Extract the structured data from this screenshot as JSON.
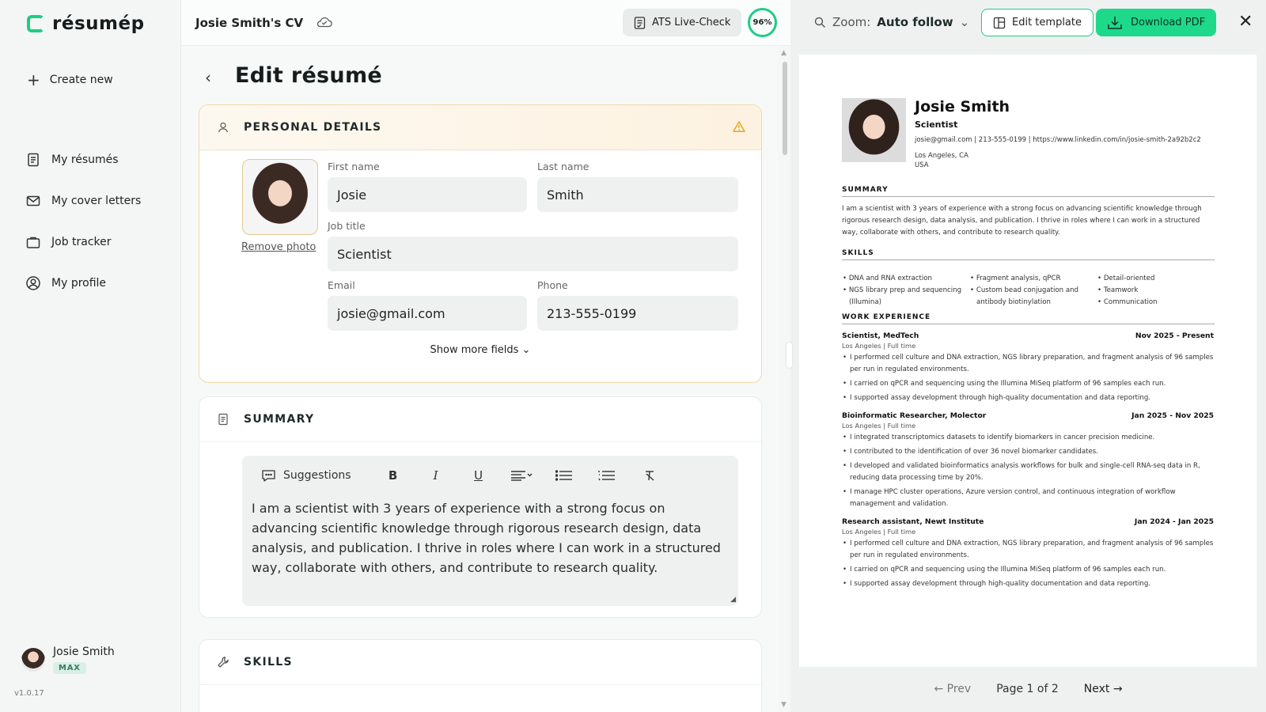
{
  "sidebar": {
    "logo": "résumép",
    "create_new": "Create new",
    "items": [
      {
        "label": "My résumés",
        "icon": "document-icon"
      },
      {
        "label": "My cover letters",
        "icon": "mail-icon"
      },
      {
        "label": "Job tracker",
        "icon": "briefcase-icon"
      },
      {
        "label": "My profile",
        "icon": "user-circle-icon"
      }
    ],
    "user_name": "Josie Smith",
    "plan": "MAX",
    "version": "v1.0.17"
  },
  "topbar": {
    "doc_title": "Josie Smith's CV",
    "ats_label": "ATS Live-Check",
    "score": "96%"
  },
  "editor": {
    "heading": "Edit résumé",
    "personal": {
      "title": "PERSONAL DETAILS",
      "remove_photo": "Remove photo",
      "first_name_label": "First name",
      "first_name": "Josie",
      "last_name_label": "Last name",
      "last_name": "Smith",
      "job_title_label": "Job title",
      "job_title": "Scientist",
      "email_label": "Email",
      "email": "josie@gmail.com",
      "phone_label": "Phone",
      "phone": "213-555-0199",
      "show_more": "Show more fields"
    },
    "summary": {
      "title": "SUMMARY",
      "suggestions": "Suggestions",
      "text": "I am a scientist with 3 years of experience with a strong focus on advancing scientific knowledge through rigorous research design, data analysis, and publication. I thrive in roles where I can work in a structured way, collaborate  with others, and contribute to research quality."
    },
    "skills_title": "SKILLS"
  },
  "preview": {
    "zoom_label": "Zoom:",
    "zoom_value": "Auto follow",
    "edit_template": "Edit template",
    "download": "Download PDF",
    "prev": "← Prev",
    "page": "Page 1 of 2",
    "next": "Next →",
    "cv": {
      "name": "Josie Smith",
      "title": "Scientist",
      "contact": "josie@gmail.com | 213-555-0199 | https://www.linkedin.com/in/josie-smith-2a92b2c2",
      "city": "Los Angeles, CA",
      "country": "USA",
      "summary_h": "SUMMARY",
      "summary": "I am a scientist with 3 years of experience with a strong focus on advancing scientific knowledge through rigorous research design, data analysis, and publication. I thrive in roles where I can work in a structured way, collaborate with others, and contribute to research quality.",
      "skills_h": "SKILLS",
      "skills": [
        [
          "DNA and RNA extraction",
          "NGS library prep and sequencing (Illumina)"
        ],
        [
          "Fragment analysis, qPCR",
          "Custom bead conjugation and antibody biotinylation"
        ],
        [
          "Detail-oriented",
          "Teamwork",
          "Communication"
        ]
      ],
      "exp_h": "WORK EXPERIENCE",
      "jobs": [
        {
          "role": "Scientist, MedTech",
          "dates": "Nov 2025 - Present",
          "sub": "Los Angeles | Full time",
          "bullets": [
            "I performed cell culture and DNA extraction, NGS library preparation, and fragment analysis of 96 samples per run in regulated environments.",
            "I carried on qPCR and sequencing using the Illumina MiSeq platform of 96 samples each run.",
            "I supported assay development through high-quality documentation and data reporting."
          ]
        },
        {
          "role": "Bioinformatic Researcher, Molector",
          "dates": "Jan 2025 - Nov 2025",
          "sub": "Los Angeles | Full time",
          "bullets": [
            "I integrated transcriptomics datasets to identify biomarkers in cancer precision medicine.",
            "I contributed to the identification of over 36 novel biomarker candidates.",
            "I developed and validated bioinformatics analysis workflows for bulk and single-cell RNA-seq data in R, reducing data processing time by 20%.",
            "I manage HPC cluster operations, Azure version control, and continuous integration of workflow management and validation."
          ]
        },
        {
          "role": "Research assistant, Newt Institute",
          "dates": "Jan 2024 - Jan 2025",
          "sub": "Los Angeles | Full time",
          "bullets": [
            "I performed cell culture and DNA extraction, NGS library preparation, and fragment analysis of 96 samples per run in regulated environments.",
            "I carried on qPCR and sequencing using the Illumina MiSeq platform of 96 samples each run.",
            "I supported assay development through high-quality documentation and data reporting."
          ]
        }
      ]
    }
  },
  "colors": {
    "accent": "#1fcc85",
    "warning": "#e8a317"
  }
}
